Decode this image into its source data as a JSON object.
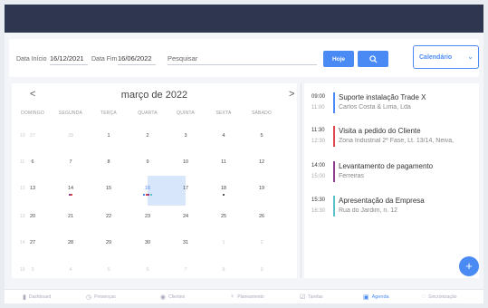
{
  "filters": {
    "start_label": "Data Início",
    "start_value": "16/12/2021",
    "end_label": "Data Fim",
    "end_value": "16/06/2022",
    "search_placeholder": "Pesquisar",
    "today_label": "Hoje",
    "view_select": "Calendário"
  },
  "calendar": {
    "month_title": "março de 2022",
    "prev": "<",
    "next": ">",
    "weekdays": [
      "DOMINGO",
      "SEGUNDA",
      "TERÇA",
      "QUARTA",
      "QUINTA",
      "SEXTA",
      "SÁBADO"
    ],
    "weeks": [
      {
        "num": "10",
        "days": [
          "27",
          "28",
          "1",
          "2",
          "3",
          "4",
          "5"
        ]
      },
      {
        "num": "11",
        "days": [
          "6",
          "7",
          "8",
          "9",
          "10",
          "11",
          "12"
        ]
      },
      {
        "num": "12",
        "days": [
          "13",
          "14",
          "15",
          "16",
          "17",
          "18",
          "19"
        ]
      },
      {
        "num": "13",
        "days": [
          "20",
          "21",
          "22",
          "23",
          "24",
          "25",
          "26"
        ]
      },
      {
        "num": "14",
        "days": [
          "27",
          "28",
          "29",
          "30",
          "31",
          "1",
          "2"
        ]
      },
      {
        "num": "15",
        "days": [
          "3",
          "4",
          "5",
          "6",
          "7",
          "8",
          "9"
        ]
      }
    ],
    "selected_day": "16",
    "colors": {
      "accent": "#4a8af4",
      "red": "#e0474c",
      "purple": "#8e3b8f",
      "teal": "#5bc0c8",
      "dark": "#555555"
    }
  },
  "events": [
    {
      "start": "09:00",
      "end": "11:00",
      "title": "Suporte instalação Trade X",
      "subtitle": "Carlos Costa & Lima, Lda",
      "color": "#4a8af4"
    },
    {
      "start": "11:30",
      "end": "12:30",
      "title": "Visita a pedido do Cliente",
      "subtitle": "Zona Industrial 2ª Fase, Lt. 13/14, Neiva,",
      "color": "#e0474c"
    },
    {
      "start": "14:00",
      "end": "15:00",
      "title": "Levantamento de pagamento",
      "subtitle": "Ferreiras",
      "color": "#8e3b8f"
    },
    {
      "start": "15:30",
      "end": "16:30",
      "title": "Apresentação da Empresa",
      "subtitle": "Rua do Jardim, n. 12",
      "color": "#5bc0c8"
    }
  ],
  "fab_label": "+",
  "bottom_nav": [
    {
      "label": "Dashboard",
      "icon": "bar-chart-icon"
    },
    {
      "label": "Presenças",
      "icon": "clock-icon"
    },
    {
      "label": "Clientes",
      "icon": "user-icon"
    },
    {
      "label": "Planeamento",
      "icon": "bulb-icon"
    },
    {
      "label": "Tarefas",
      "icon": "check-icon"
    },
    {
      "label": "Agenda",
      "icon": "calendar-icon"
    },
    {
      "label": "Sincronização",
      "icon": "sync-icon"
    }
  ]
}
